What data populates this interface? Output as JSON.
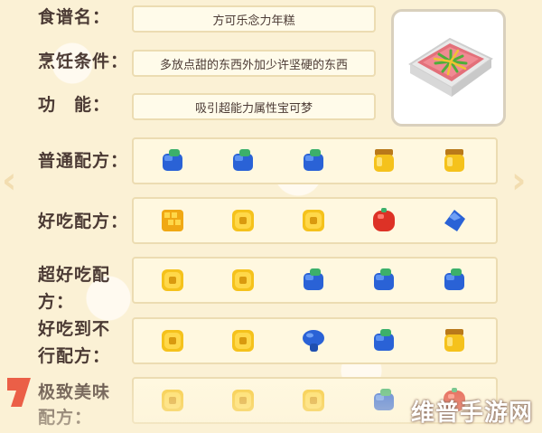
{
  "recipe": {
    "name_label": "食谱名：",
    "name_value": "方可乐念力年糕",
    "condition_label": "烹饪条件：",
    "condition_value": "多放点甜的东西外加少许坚硬的东西",
    "function_label": "功　能：",
    "function_value": "吸引超能力属性宝可梦"
  },
  "tiers": [
    {
      "label_line1": "普通配方：",
      "label_line2": "",
      "ingredients": [
        "blue-berry-icon",
        "blue-berry-icon",
        "blue-berry-icon",
        "honey-pot-icon",
        "honey-pot-icon"
      ]
    },
    {
      "label_line1": "好吃配方：",
      "label_line2": "",
      "ingredients": [
        "honeycomb-icon",
        "yellow-apricorn-icon",
        "yellow-apricorn-icon",
        "red-berry-icon",
        "blue-gem-berry-icon"
      ]
    },
    {
      "label_line1": "超好吃配",
      "label_line2": "方：",
      "ingredients": [
        "yellow-apricorn-icon",
        "yellow-apricorn-icon",
        "blue-berry-icon",
        "blue-berry-icon",
        "blue-berry-icon"
      ]
    },
    {
      "label_line1": "好吃到不",
      "label_line2": "行配方：",
      "ingredients": [
        "yellow-apricorn-icon",
        "yellow-apricorn-icon",
        "blue-mushroom-icon",
        "blue-berry-icon",
        "honey-pot-icon"
      ]
    },
    {
      "label_line1": "极致美味",
      "label_line2": "配方：",
      "ingredients": [
        "yellow-apricorn-icon",
        "yellow-apricorn-icon",
        "yellow-apricorn-icon",
        "blue-berry-icon",
        "red-berry-icon"
      ]
    }
  ],
  "watermark": "维普手游网",
  "colors": {
    "label_text": "#4b3a34",
    "field_border": "#ecdcb2",
    "blue": "#2f6fe0",
    "yellow": "#f5c21c",
    "red": "#e0372f"
  }
}
